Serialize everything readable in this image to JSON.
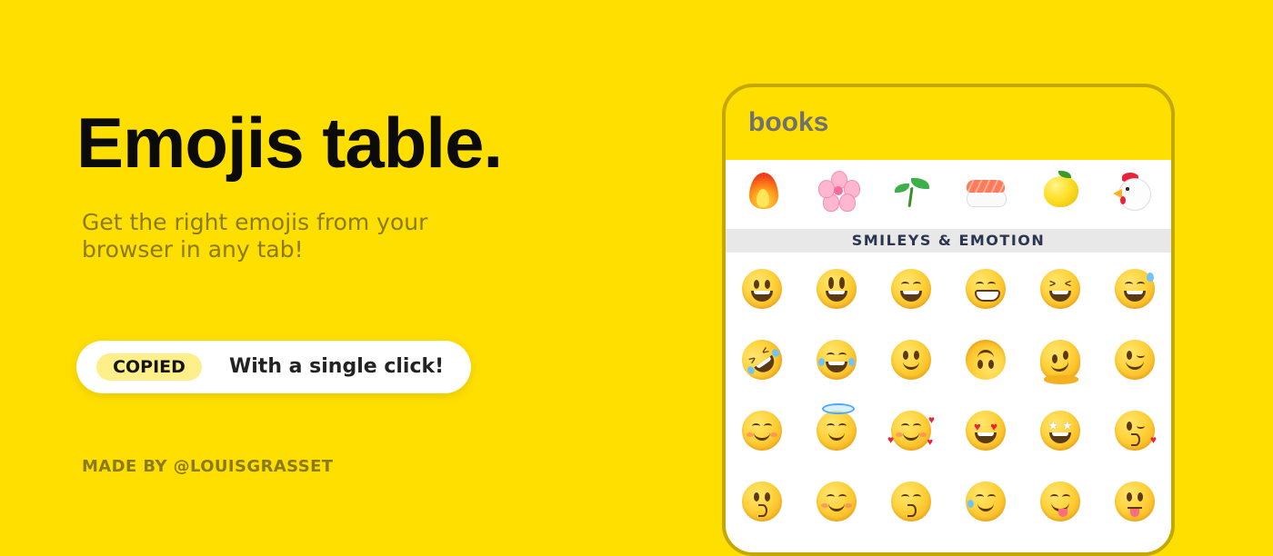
{
  "hero": {
    "title": "Emojis table.",
    "subtitle": "Get the right emojis from your browser in any tab!",
    "copied_badge": "COPIED",
    "copied_text": "With a single click!",
    "credit": "MADE BY @LOUISGRASSET"
  },
  "phone": {
    "search_value": "books",
    "category_label": "SMILEYS & EMOTION",
    "top_icons": [
      "fire-icon",
      "cherry-blossom-icon",
      "seedling-icon",
      "sushi-icon",
      "lemon-icon",
      "rooster-icon"
    ],
    "grid_rows": [
      [
        "grinning-face",
        "grinning-face-big-eyes",
        "grinning-face-smiling-eyes",
        "beaming-face",
        "grinning-squinting-face",
        "grinning-face-sweat"
      ],
      [
        "rolling-on-floor-laughing",
        "face-tears-of-joy",
        "slightly-smiling-face",
        "upside-down-face",
        "melting-face",
        "winking-face"
      ],
      [
        "smiling-face-smiling-eyes",
        "smiling-face-halo",
        "smiling-face-hearts",
        "heart-eyes-face",
        "star-struck-face",
        "face-blowing-kiss"
      ],
      [
        "kissing-face",
        "smiling-face",
        "kissing-face-closed-eyes",
        "smiling-face-tear",
        "face-savoring-food",
        "face-with-tongue"
      ]
    ]
  },
  "colors": {
    "background": "#FFDF00",
    "phone_border": "#c4a800",
    "badge_bg": "#FFEF8A",
    "muted_text": "#8a7a1a",
    "category_text": "#2a3550"
  }
}
